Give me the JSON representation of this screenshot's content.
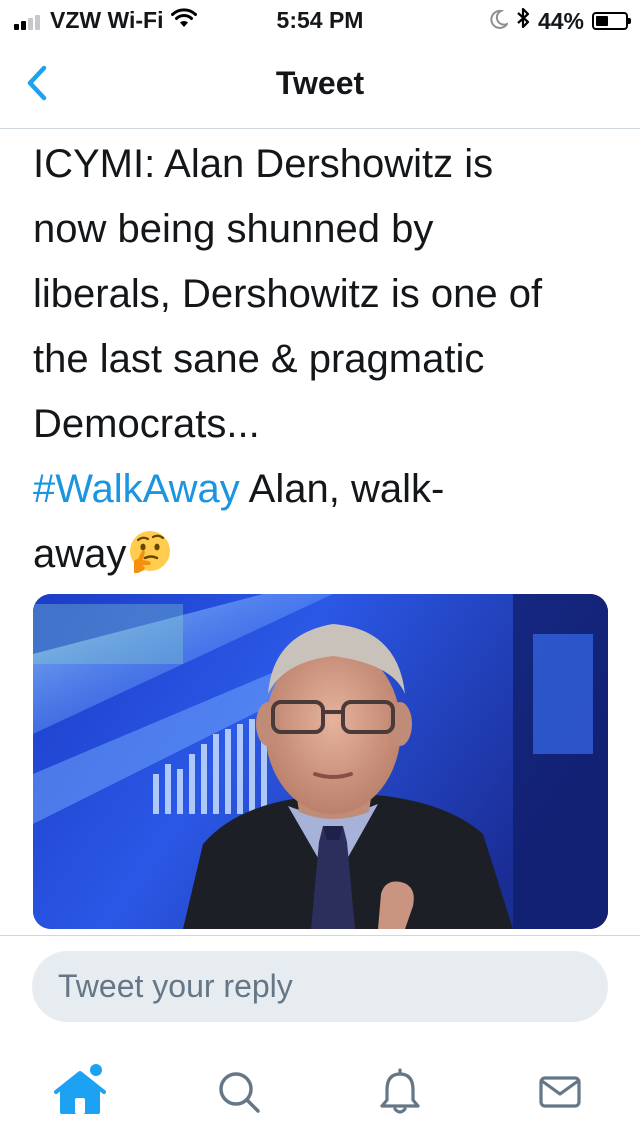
{
  "status_bar": {
    "carrier": "VZW Wi-Fi",
    "time": "5:54 PM",
    "battery_percent": "44%",
    "battery_level": 0.44,
    "signal_bars_filled": 2,
    "icons": [
      "signal-bars-icon",
      "wifi-icon",
      "moon-icon",
      "bluetooth-icon",
      "battery-icon"
    ]
  },
  "header": {
    "back_icon": "chevron-left-icon",
    "title": "Tweet"
  },
  "tweet": {
    "lines": [
      "ICYMI: Alan Dershowitz is",
      "now being shunned by",
      "liberals, Dershowitz is one of",
      "the last sane & pragmatic",
      "Democrats..."
    ],
    "hashtag": "#WalkAway",
    "after_hashtag": " Alan, walk-",
    "last_line": "away",
    "emoji": "thinking-face-emoji",
    "media": "photo of man in glasses and suit on TV news set"
  },
  "reply": {
    "placeholder": "Tweet your reply"
  },
  "tab_bar": {
    "items": [
      {
        "icon": "home-icon",
        "active": true,
        "has_notification_dot": true
      },
      {
        "icon": "search-icon",
        "active": false
      },
      {
        "icon": "notifications-bell-icon",
        "active": false
      },
      {
        "icon": "messages-envelope-icon",
        "active": false
      }
    ]
  },
  "colors": {
    "accent": "#1da1f2",
    "hashtag": "#1b95e0",
    "text": "#14171a",
    "secondary_text": "#657786",
    "reply_background": "#e6ecf0",
    "divider": "#cfd6dc"
  }
}
